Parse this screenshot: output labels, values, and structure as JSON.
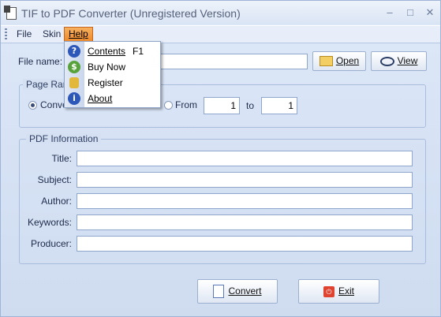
{
  "window": {
    "title": "TIF to PDF Converter (Unregistered Version)"
  },
  "menubar": {
    "file": "File",
    "skin": "Skin",
    "help": "Help"
  },
  "help_menu": {
    "items": [
      {
        "label": "Contents",
        "shortcut": "F1",
        "icon": "help-icon"
      },
      {
        "label": "Buy Now",
        "icon": "money-icon"
      },
      {
        "label": "Register",
        "icon": "lock-icon"
      },
      {
        "label": "About",
        "icon": "info-icon"
      }
    ]
  },
  "file_row": {
    "label": "File name:",
    "value": "",
    "open_label": "Open",
    "view_label": "View"
  },
  "page_range": {
    "title": "Page Ran",
    "option_all": "Conve",
    "option_all_selected": true,
    "from_label": "From",
    "from_value": "1",
    "to_label": "to",
    "to_value": "1"
  },
  "pdf_info": {
    "title": "PDF Information",
    "fields": [
      {
        "label": "Title:",
        "value": ""
      },
      {
        "label": "Subject:",
        "value": ""
      },
      {
        "label": "Author:",
        "value": ""
      },
      {
        "label": "Keywords:",
        "value": ""
      },
      {
        "label": "Producer:",
        "value": ""
      }
    ]
  },
  "actions": {
    "convert_label": "Convert",
    "exit_label": "Exit"
  }
}
